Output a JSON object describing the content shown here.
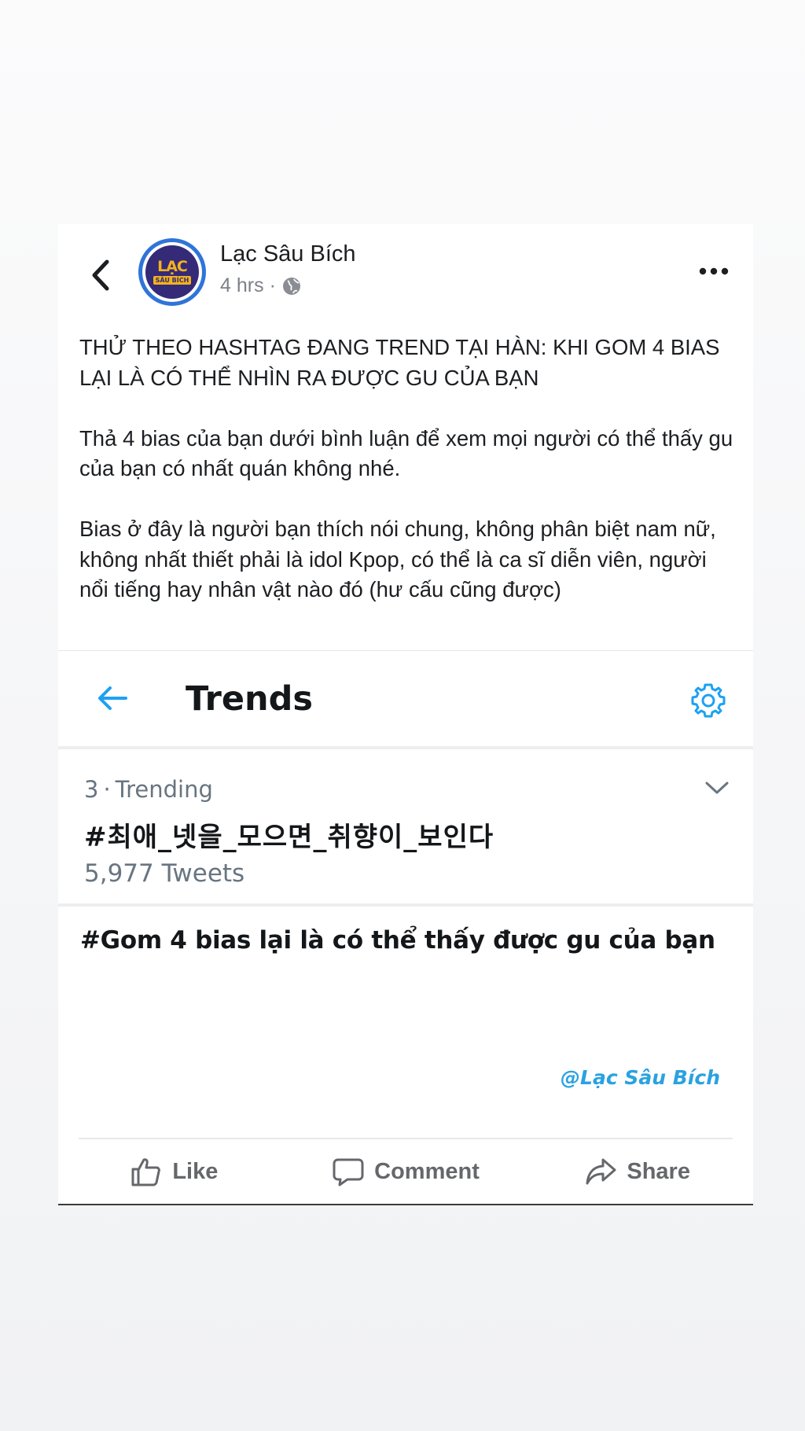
{
  "post": {
    "page_name": "Lạc Sâu Bích",
    "time": "4 hrs",
    "separator": "·",
    "avatar_text": "LẠC",
    "avatar_subtext": "SÂU BÍCH",
    "paragraphs": [
      "THỬ THEO HASHTAG ĐANG TREND TẠI HÀN: KHI GOM 4 BIAS LẠI LÀ CÓ THỂ NHÌN RA ĐƯỢC GU CỦA BẠN",
      "Thả 4 bias của bạn dưới bình luận để xem mọi người có thể thấy gu của bạn có nhất quán không nhé.",
      "Bias ở đây là người bạn thích nói chung, không phân biệt nam nữ, không nhất thiết phải là idol Kpop, có thể là ca sĩ diễn viên, người nổi tiếng hay nhân vật nào đó (hư cấu cũng được)"
    ]
  },
  "embed": {
    "title": "Trends",
    "trend_rank": "3",
    "trend_label": "Trending",
    "trend_separator": "·",
    "hashtag": "#최애_넷을_모으면_취향이_보인다",
    "tweet_count": "5,977 Tweets",
    "caption": "#Gom 4 bias lại là có thể thấy được gu của bạn",
    "watermark": "@Lạc Sâu Bích"
  },
  "actions": {
    "like": "Like",
    "comment": "Comment",
    "share": "Share"
  },
  "icons": [
    "back-arrow-icon",
    "globe-icon",
    "more-icon",
    "twitter-back-arrow-icon",
    "gear-icon",
    "chevron-down-icon",
    "like-icon",
    "comment-icon",
    "share-icon"
  ],
  "colors": {
    "twitter_blue": "#1da1f2",
    "fb_gray": "#65676b",
    "text": "#1c1e21"
  }
}
